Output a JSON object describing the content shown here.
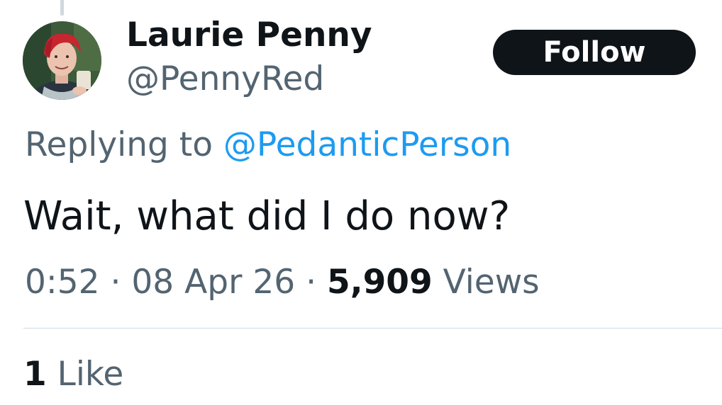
{
  "tweet": {
    "author": {
      "display_name": "Laurie Penny",
      "handle": "@PennyRed"
    },
    "follow_label": "Follow",
    "replying_prefix": "Replying to ",
    "replying_to": "@PedanticPerson",
    "text": "Wait, what did I do now?",
    "time": "0:52",
    "separator": " · ",
    "date": "08 Apr 26",
    "views_count": "5,909",
    "views_label": " Views",
    "likes_count": "1",
    "likes_label": " Like"
  },
  "colors": {
    "text_primary": "#0f1419",
    "text_secondary": "#536471",
    "link": "#1d9bf0",
    "button_bg": "#0f1419",
    "divider": "#cfd9de"
  },
  "icons": [
    "avatar-photo"
  ]
}
